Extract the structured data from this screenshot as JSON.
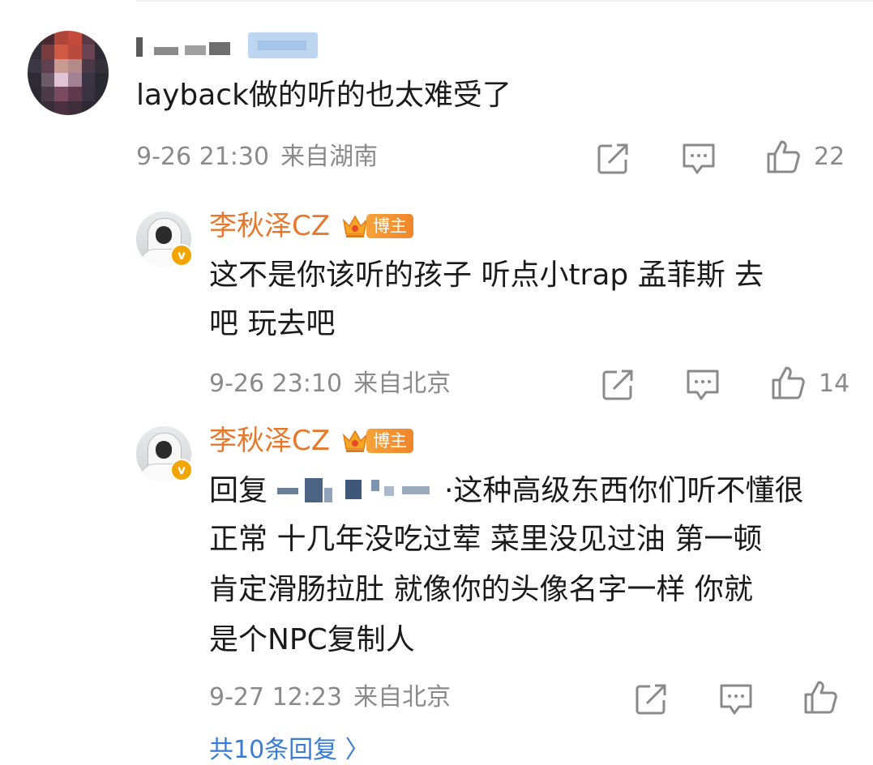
{
  "main_comment": {
    "text": "layback做的听的也太难受了",
    "time": "9-26 21:30",
    "location": "来自湖南",
    "likes": "22"
  },
  "replies": [
    {
      "author": "李秋泽CZ",
      "badge": "博主",
      "text_line1": "这不是你该听的孩子 听点小trap 孟菲斯 去",
      "text_line2": "吧 玩去吧",
      "time": "9-26 23:10",
      "location": "来自北京",
      "likes": "14"
    },
    {
      "author": "李秋泽CZ",
      "badge": "博主",
      "reply_prefix": "回复",
      "text_line1_rest": "·这种高级东西你们听不懂很",
      "text_line2": "正常 十几年没吃过荤 菜里没见过油 第一顿",
      "text_line3": "肯定滑肠拉肚 就像你的头像名字一样 你就",
      "text_line4": "是个NPC复制人",
      "time": "9-27 12:23",
      "location": "来自北京",
      "likes": ""
    }
  ],
  "more_replies": "共10条回复 〉",
  "icons": [
    "share-icon",
    "comment-icon",
    "like-icon",
    "crown-icon",
    "verified-icon"
  ],
  "colors": {
    "author": "#e8772a",
    "meta": "#8a8a8a",
    "badge": "#f0862a",
    "link": "#3a7bd5"
  }
}
